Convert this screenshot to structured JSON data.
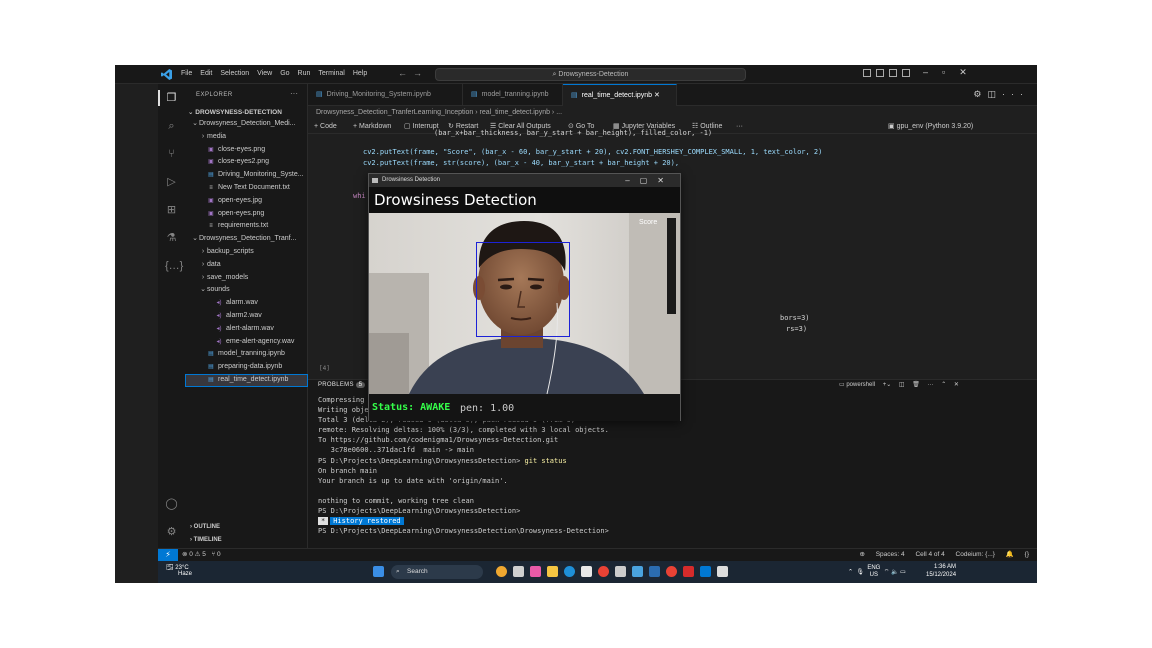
{
  "window": {
    "search_title": "Drowsyness-Detection",
    "menu": [
      "File",
      "Edit",
      "Selection",
      "View",
      "Go",
      "Run",
      "Terminal",
      "Help"
    ]
  },
  "sidebar": {
    "title": "EXPLORER",
    "root": "DROWSYNESS-DETECTION",
    "tree": [
      {
        "label": "Drowsyness_Detection_Medi...",
        "indent": 0,
        "chevron": "⌄",
        "type": "folder"
      },
      {
        "label": "media",
        "indent": 1,
        "chevron": "›",
        "type": "folder"
      },
      {
        "label": "close-eyes.png",
        "indent": 1,
        "chevron": "",
        "type": "img"
      },
      {
        "label": "close-eyes2.png",
        "indent": 1,
        "chevron": "",
        "type": "img"
      },
      {
        "label": "Driving_Monitoring_Syste...",
        "indent": 1,
        "chevron": "",
        "type": "nb"
      },
      {
        "label": "New Text Document.txt",
        "indent": 1,
        "chevron": "",
        "type": "txt"
      },
      {
        "label": "open-eyes.jpg",
        "indent": 1,
        "chevron": "",
        "type": "img"
      },
      {
        "label": "open-eyes.png",
        "indent": 1,
        "chevron": "",
        "type": "img"
      },
      {
        "label": "requirements.txt",
        "indent": 1,
        "chevron": "",
        "type": "txt"
      },
      {
        "label": "Drowsyness_Detection_Tranf...",
        "indent": 0,
        "chevron": "⌄",
        "type": "folder"
      },
      {
        "label": "backup_scripts",
        "indent": 1,
        "chevron": "›",
        "type": "folder"
      },
      {
        "label": "data",
        "indent": 1,
        "chevron": "›",
        "type": "folder"
      },
      {
        "label": "save_models",
        "indent": 1,
        "chevron": "›",
        "type": "folder"
      },
      {
        "label": "sounds",
        "indent": 1,
        "chevron": "⌄",
        "type": "folder"
      },
      {
        "label": "alarm.wav",
        "indent": 2,
        "chevron": "",
        "type": "wav"
      },
      {
        "label": "alarm2.wav",
        "indent": 2,
        "chevron": "",
        "type": "wav"
      },
      {
        "label": "alert-alarm.wav",
        "indent": 2,
        "chevron": "",
        "type": "wav"
      },
      {
        "label": "eme-alert-agency.wav",
        "indent": 2,
        "chevron": "",
        "type": "wav"
      },
      {
        "label": "model_tranning.ipynb",
        "indent": 1,
        "chevron": "",
        "type": "nb"
      },
      {
        "label": "preparing-data.ipynb",
        "indent": 1,
        "chevron": "",
        "type": "nb"
      },
      {
        "label": "real_time_detect.ipynb",
        "indent": 1,
        "chevron": "",
        "type": "nb",
        "selected": true
      }
    ],
    "outline": "OUTLINE",
    "timeline": "TIMELINE"
  },
  "tabs": [
    {
      "label": "Driving_Monitoring_System.ipynb",
      "active": false
    },
    {
      "label": "model_tranning.ipynb",
      "active": false
    },
    {
      "label": "real_time_detect.ipynb",
      "active": true
    }
  ],
  "breadcrumb": "Drowsyness_Detection_TranferLearning_Inception  ›  real_time_detect.ipynb  ›  ...",
  "toolbar": {
    "code": "+ Code",
    "markdown": "+ Markdown",
    "interrupt": "Interrupt",
    "restart": "Restart",
    "clear": "Clear All Outputs",
    "goto": "Go To",
    "variables": "Jupyter Variables",
    "outline": "Outline",
    "kernel": "gpu_env (Python 3.9.20)"
  },
  "code": {
    "line0": "(bar_x+bar_thickness, bar_y_start + bar_height), filled_color, -1)",
    "line1": "cv2.putText(frame, \"Score\", (bar_x - 60, bar_y_start + 20), cv2.FONT_HERSHEY_COMPLEX_SMALL, 1, text_color, 2)",
    "line2": "cv2.putText(frame, str(score), (bar_x - 40, bar_y_start + bar_height + 20),",
    "whi": "whi",
    "frag1": "bors=3)",
    "frag2": "rs=3)",
    "cell": "[4]"
  },
  "panel": {
    "problems": "PROBLEMS",
    "problems_count": "5",
    "shell": "powershell",
    "terminal": [
      {
        "text": "Compressing objects: 100% (3/3), done.",
        "cmd": false
      },
      {
        "text": "Writing objects: 100% (3/3), 300 bytes | 300.00 KiB/s, done.",
        "cmd": false
      },
      {
        "text": "Total 3 (delta 2), reused 0 (delta 0), pack-reused 0 (from 0)",
        "cmd": false
      },
      {
        "text": "remote: Resolving deltas: 100% (3/3), completed with 3 local objects.",
        "cmd": false
      },
      {
        "text": "To https://github.com/codenigma1/Drowsyness-Detection.git",
        "cmd": false
      },
      {
        "text": "   3c78e0600..371dac1fd  main -> main",
        "cmd": false
      },
      {
        "text": "PS D:\\Projects\\DeepLearning\\DrowsynessDetection> ",
        "cmd": true,
        "command": "git status"
      },
      {
        "text": "On branch main",
        "cmd": false
      },
      {
        "text": "Your branch is up to date with 'origin/main'.",
        "cmd": false
      },
      {
        "text": "",
        "cmd": false
      },
      {
        "text": "nothing to commit, working tree clean",
        "cmd": false
      },
      {
        "text": "PS D:\\Projects\\DeepLearning\\DrowsynessDetection>",
        "cmd": false
      }
    ],
    "history": "History restored",
    "last_prompt": "PS D:\\Projects\\DeepLearning\\DrowsynessDetection\\Drowsyness-Detection>"
  },
  "statusbar": {
    "errors": "⊗ 0 ⚠ 5",
    "ports": "⑂ 0",
    "spaces": "Spaces: 4",
    "cell": "Cell 4 of 4",
    "codeium": "Codeium: {...}"
  },
  "cvwindow": {
    "title": "Drowsiness Detection",
    "heading": "Drowsiness Detection",
    "score_label": "Score",
    "status": "Status: AWAKE",
    "ear_text": "pen: 1.00"
  },
  "taskbar": {
    "temp": "23°C",
    "weather": "Haze",
    "search": "Search",
    "lang": "ENG",
    "region": "US",
    "time": "1:36 AM",
    "date": "15/12/2024"
  },
  "colors": {
    "accent": "#0078d4",
    "status_green": "#35ff4a",
    "face_box": "#1c22d6"
  }
}
